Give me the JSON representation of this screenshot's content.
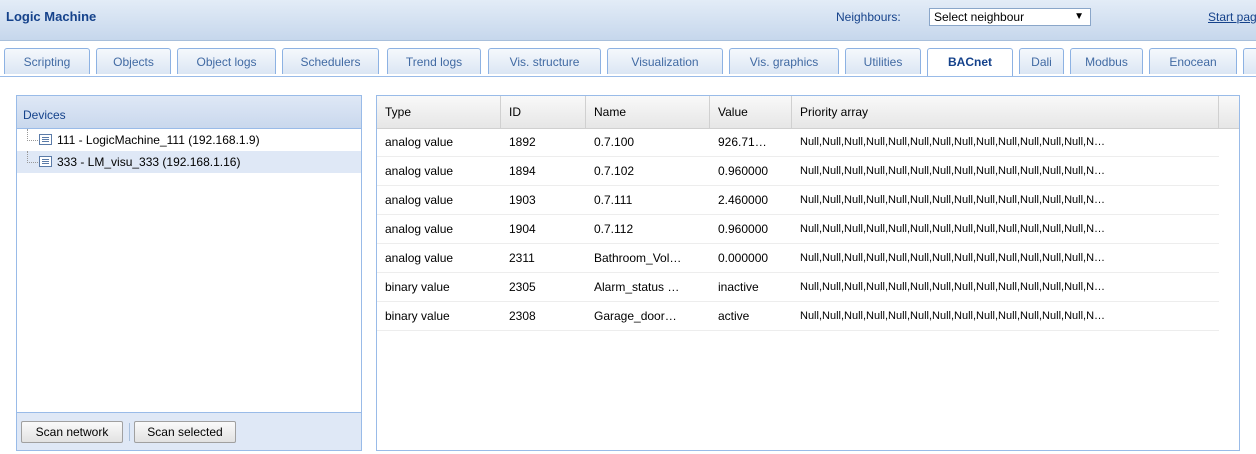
{
  "header": {
    "app_title": "Logic Machine",
    "neighbours_label": "Neighbours:",
    "neighbour_select_value": "Select neighbour",
    "start_page_link": "Start page"
  },
  "tabs": [
    {
      "label": "Scripting"
    },
    {
      "label": "Objects"
    },
    {
      "label": "Object logs"
    },
    {
      "label": "Schedulers"
    },
    {
      "label": "Trend logs"
    },
    {
      "label": "Vis. structure"
    },
    {
      "label": "Visualization"
    },
    {
      "label": "Vis. graphics"
    },
    {
      "label": "Utilities"
    },
    {
      "label": "BACnet",
      "active": true
    },
    {
      "label": "Dali"
    },
    {
      "label": "Modbus"
    },
    {
      "label": "Enocean"
    }
  ],
  "devices": {
    "title": "Devices",
    "items": [
      {
        "label": "111 - LogicMachine_111 (192.168.1.9)"
      },
      {
        "label": "333 - LM_visu_333 (192.168.1.16)",
        "selected": true
      }
    ],
    "scan_network_label": "Scan network",
    "scan_selected_label": "Scan selected"
  },
  "objects_table": {
    "columns": [
      "Type",
      "ID",
      "Name",
      "Value",
      "Priority array"
    ],
    "rows": [
      {
        "type": "analog value",
        "id": "1892",
        "name": "0.7.100",
        "value": "926.71…",
        "priority": "Null,Null,Null,Null,Null,Null,Null,Null,Null,Null,Null,Null,Null,N…"
      },
      {
        "type": "analog value",
        "id": "1894",
        "name": "0.7.102",
        "value": "0.960000",
        "priority": "Null,Null,Null,Null,Null,Null,Null,Null,Null,Null,Null,Null,Null,N…"
      },
      {
        "type": "analog value",
        "id": "1903",
        "name": "0.7.111",
        "value": "2.460000",
        "priority": "Null,Null,Null,Null,Null,Null,Null,Null,Null,Null,Null,Null,Null,N…"
      },
      {
        "type": "analog value",
        "id": "1904",
        "name": "0.7.112",
        "value": "0.960000",
        "priority": "Null,Null,Null,Null,Null,Null,Null,Null,Null,Null,Null,Null,Null,N…"
      },
      {
        "type": "analog value",
        "id": "2311",
        "name": "Bathroom_Vol…",
        "value": "0.000000",
        "priority": "Null,Null,Null,Null,Null,Null,Null,Null,Null,Null,Null,Null,Null,N…"
      },
      {
        "type": "binary value",
        "id": "2305",
        "name": "Alarm_status …",
        "value": "inactive",
        "priority": "Null,Null,Null,Null,Null,Null,Null,Null,Null,Null,Null,Null,Null,N…"
      },
      {
        "type": "binary value",
        "id": "2308",
        "name": "Garage_door…",
        "value": "active",
        "priority": "Null,Null,Null,Null,Null,Null,Null,Null,Null,Null,Null,Null,Null,N…"
      }
    ]
  }
}
